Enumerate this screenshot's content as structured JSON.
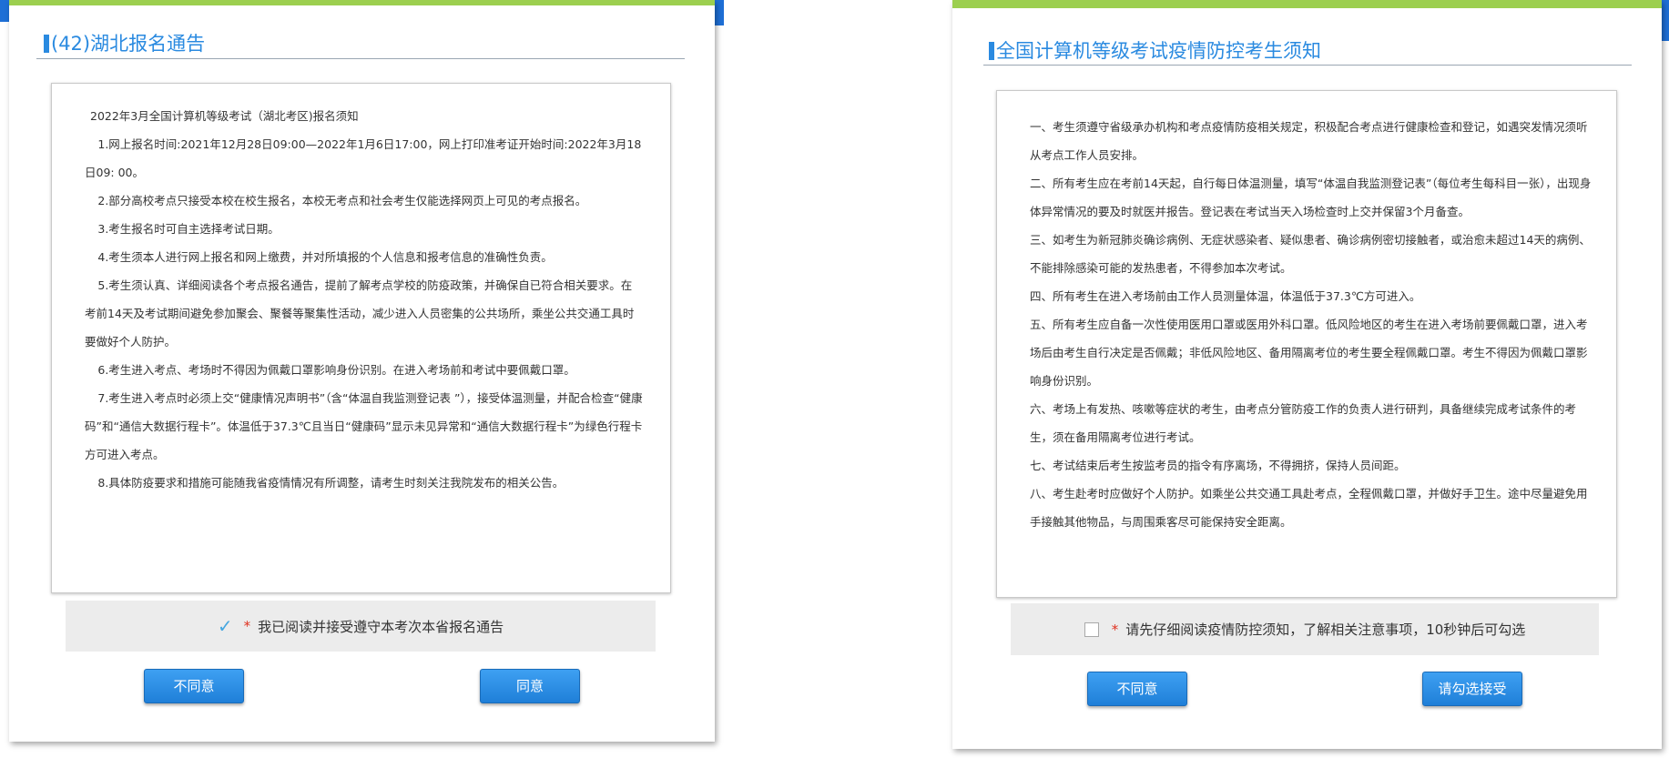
{
  "colors": {
    "accent_blue": "#2a8ae0",
    "top_strip_green": "#9ccf4f",
    "button_blue": "#2a8ee6",
    "required_star": "#e0301e",
    "check_color": "#45a6e0"
  },
  "left_panel": {
    "title": "(42)湖北报名通告",
    "notice_lines": [
      "2022年3月全国计算机等级考试（湖北考区)报名须知",
      "1.网上报名时间:2021年12月28日09:00—2022年1月6日17:00，网上打印准考证开始时间:2022年3月18日09: 00。",
      "2.部分高校考点只接受本校在校生报名，本校无考点和社会考生仅能选择网页上可见的考点报名。",
      "3.考生报名时可自主选择考试日期。",
      "4.考生须本人进行网上报名和网上缴费，并对所填报的个人信息和报考信息的准确性负责。",
      "5.考生须认真、详细阅读各个考点报名通告，提前了解考点学校的防疫政策，并确保自已符合相关要求。在考前14天及考试期间避免参加聚会、聚餐等聚集性活动，减少进入人员密集的公共场所，乘坐公共交通工具时要做好个人防护。",
      "6.考生进入考点、考场时不得因为佩戴口罩影响身份识别。在进入考场前和考试中要佩戴口罩。",
      "7.考生进入考点时必须上交“健康情况声明书”（含“体温自我监测登记表 ”），接受体温测量，并配合检查“健康码”和“通信大数据行程卡”。体温低于37.3℃且当日“健康码”显示未见异常和“通信大数据行程卡”为绿色行程卡方可进入考点。",
      "8.具体防疫要求和措施可能随我省疫情情况有所调整，请考生时刻关注我院发布的相关公告。"
    ],
    "ack_icon": "checkmark-icon",
    "ack_star": "*",
    "ack_text": "我已阅读并接受遵守本考次本省报名通告",
    "disagree_label": "不同意",
    "agree_label": "同意"
  },
  "right_panel": {
    "title": "全国计算机等级考试疫情防控考生须知",
    "notice_lines": [
      "一、考生须遵守省级承办机构和考点疫情防疫相关规定，积极配合考点进行健康检查和登记，如遇突发情况须听从考点工作人员安排。",
      "二、所有考生应在考前14天起，自行每日体温测量，填写“体温自我监测登记表”（每位考生每科目一张），出现身体异常情况的要及时就医并报告。登记表在考试当天入场检查时上交并保留3个月备查。",
      "三、如考生为新冠肺炎确诊病例、无症状感染者、疑似患者、确诊病例密切接触者，或治愈未超过14天的病例、不能排除感染可能的发热患者，不得参加本次考试。",
      "四、所有考生在进入考场前由工作人员测量体温，体温低于37.3℃方可进入。",
      "五、所有考生应自备一次性使用医用口罩或医用外科口罩。低风险地区的考生在进入考场前要佩戴口罩，进入考场后由考生自行决定是否佩戴；非低风险地区、备用隔离考位的考生要全程佩戴口罩。考生不得因为佩戴口罩影响身份识别。",
      "六、考场上有发热、咳嗽等症状的考生，由考点分管防疫工作的负责人进行研判，具备继续完成考试条件的考生，须在备用隔离考位进行考试。",
      "七、考试结束后考生按监考员的指令有序离场，不得拥挤，保持人员间距。",
      "八、考生赴考时应做好个人防护。如乘坐公共交通工具赴考点，全程佩戴口罩，并做好手卫生。途中尽量避免用手接触其他物品，与周围乘客尽可能保持安全距离。"
    ],
    "ack_icon": "checkbox-icon",
    "ack_star": "*",
    "ack_text": "请先仔细阅读疫情防控须知，了解相关注意事项，10秒钟后可勾选",
    "disagree_label": "不同意",
    "accept_label": "请勾选接受"
  }
}
